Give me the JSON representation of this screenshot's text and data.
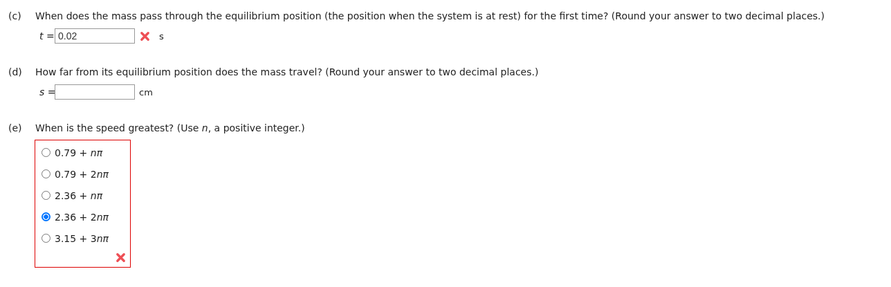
{
  "parts": [
    {
      "kind": "input",
      "label": "(c)",
      "question": "When does the mass pass through the equilibrium position (the position when the system is at rest) for the first time? (Round your answer to two decimal places.)",
      "prefix": "*t* =",
      "value": "0.02",
      "unit": "s",
      "correct": false
    },
    {
      "kind": "input",
      "label": "(d)",
      "question": "How far from its equilibrium position does the mass travel? (Round your answer to two decimal places.)",
      "prefix": "*s* =",
      "unit": "cm"
    },
    {
      "kind": "choice",
      "label": "(e)",
      "question": "When is the speed greatest? (Use *n*, a positive integer.)",
      "correct": false,
      "options": [
        {
          "text": "0.79 + ",
          "variable": "nπ",
          "selected": false
        },
        {
          "text": "0.79 + 2",
          "variable": "nπ",
          "selected": false
        },
        {
          "text": "2.36 + ",
          "variable": "nπ",
          "selected": false
        },
        {
          "text": "2.36 + 2",
          "variable": "nπ",
          "selected": true
        },
        {
          "text": "3.15 + 3",
          "variable": "nπ",
          "selected": false
        }
      ]
    }
  ]
}
